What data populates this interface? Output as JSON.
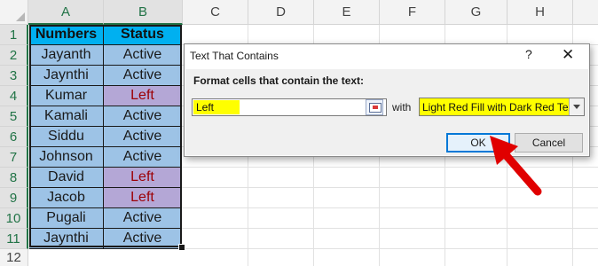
{
  "spreadsheet": {
    "columns": [
      "A",
      "B",
      "C",
      "D",
      "E",
      "F",
      "G",
      "H"
    ],
    "rows": [
      "1",
      "2",
      "3",
      "4",
      "5",
      "6",
      "7",
      "8",
      "9",
      "10",
      "11",
      "12"
    ],
    "header": {
      "numbers": "Numbers",
      "status": "Status"
    },
    "data": [
      {
        "name": "Jayanth",
        "status": "Active"
      },
      {
        "name": "Jaynthi",
        "status": "Active"
      },
      {
        "name": "Kumar",
        "status": "Left"
      },
      {
        "name": "Kamali",
        "status": "Active"
      },
      {
        "name": "Siddu",
        "status": "Active"
      },
      {
        "name": "Johnson",
        "status": "Active"
      },
      {
        "name": "David",
        "status": "Left"
      },
      {
        "name": "Jacob",
        "status": "Left"
      },
      {
        "name": "Pugali",
        "status": "Active"
      },
      {
        "name": "Jaynthi",
        "status": "Active"
      }
    ]
  },
  "dialog": {
    "title": "Text That Contains",
    "help": "?",
    "close": "✕",
    "prompt": "Format cells that contain the text:",
    "text_value": "Left",
    "with_label": "with",
    "format_value": "Light Red Fill with Dark Red Text",
    "ok_label": "OK",
    "cancel_label": "Cancel"
  },
  "colors": {
    "header_fill": "#00b0f0",
    "cell_fill": "#9dc3e6",
    "highlight_fill": "#b4a7d6",
    "highlight_text": "#9c0006",
    "arrow": "#e00000"
  }
}
